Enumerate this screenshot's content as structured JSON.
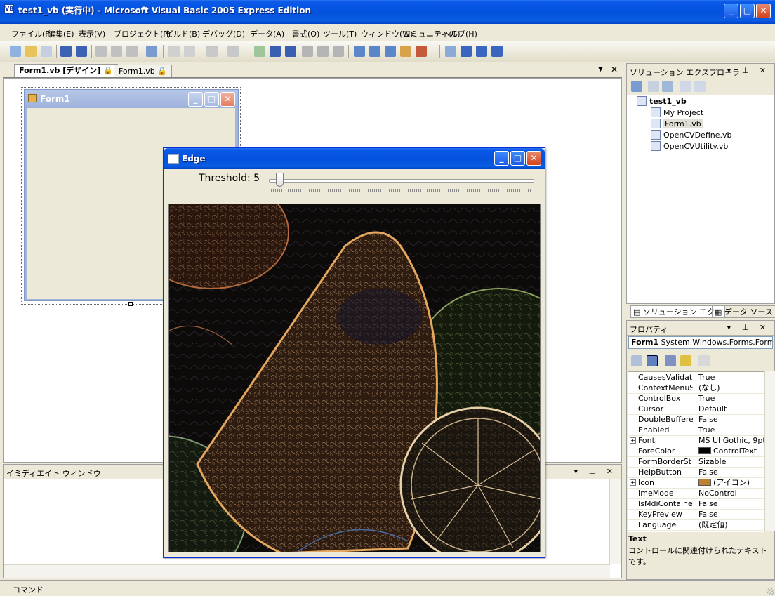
{
  "window": {
    "title": "test1_vb (実行中) - Microsoft Visual Basic 2005 Express Edition",
    "icon": "vb-app-icon"
  },
  "menu": [
    "ファイル(F)",
    "編集(E)",
    "表示(V)",
    "プロジェクト(P)",
    "ビルド(B)",
    "デバッグ(D)",
    "データ(A)",
    "書式(O)",
    "ツール(T)",
    "ウィンドウ(W)",
    "コミュニティ(C)",
    "ヘルプ(H)"
  ],
  "doc_tabs": [
    "Form1.vb [デザイン]",
    "Form1.vb"
  ],
  "form1": {
    "title": "Form1"
  },
  "edge_window": {
    "title": "Edge",
    "threshold_label": "Threshold: 5",
    "threshold_value": 5
  },
  "immediate": {
    "title": "イミディエイト ウィンドウ"
  },
  "statusbar": {
    "text": "コマンド"
  },
  "solution_explorer": {
    "title": "ソリューション エクスプローラ",
    "items": [
      "test1_vb",
      "My Project",
      "Form1.vb",
      "OpenCVDefine.vb",
      "OpenCVUtility.vb"
    ]
  },
  "bottom_tabs": [
    "ソリューション エク...",
    "データ ソース"
  ],
  "properties": {
    "title": "プロパティ",
    "object_name": "Form1",
    "object_type": "System.Windows.Forms.Form",
    "rows": [
      {
        "name": "CausesValidat",
        "value": "True",
        "expand": false
      },
      {
        "name": "ContextMenuS",
        "value": "(なし)",
        "expand": false
      },
      {
        "name": "ControlBox",
        "value": "True",
        "expand": false
      },
      {
        "name": "Cursor",
        "value": "Default",
        "expand": false
      },
      {
        "name": "DoubleBuffere",
        "value": "False",
        "expand": false
      },
      {
        "name": "Enabled",
        "value": "True",
        "expand": false
      },
      {
        "name": "Font",
        "value": "MS UI Gothic, 9pt",
        "expand": true
      },
      {
        "name": "ForeColor",
        "value": "ControlText",
        "expand": false,
        "swatch": "#000000"
      },
      {
        "name": "FormBorderSt",
        "value": "Sizable",
        "expand": false
      },
      {
        "name": "HelpButton",
        "value": "False",
        "expand": false
      },
      {
        "name": "Icon",
        "value": "(アイコン)",
        "expand": true,
        "swatch": "#c08030"
      },
      {
        "name": "ImeMode",
        "value": "NoControl",
        "expand": false
      },
      {
        "name": "IsMdiContaine",
        "value": "False",
        "expand": false
      },
      {
        "name": "KeyPreview",
        "value": "False",
        "expand": false
      },
      {
        "name": "Language",
        "value": "(既定値)",
        "expand": false
      }
    ],
    "description_title": "Text",
    "description_text": "コントロールに関連付けられたテキストです。"
  }
}
